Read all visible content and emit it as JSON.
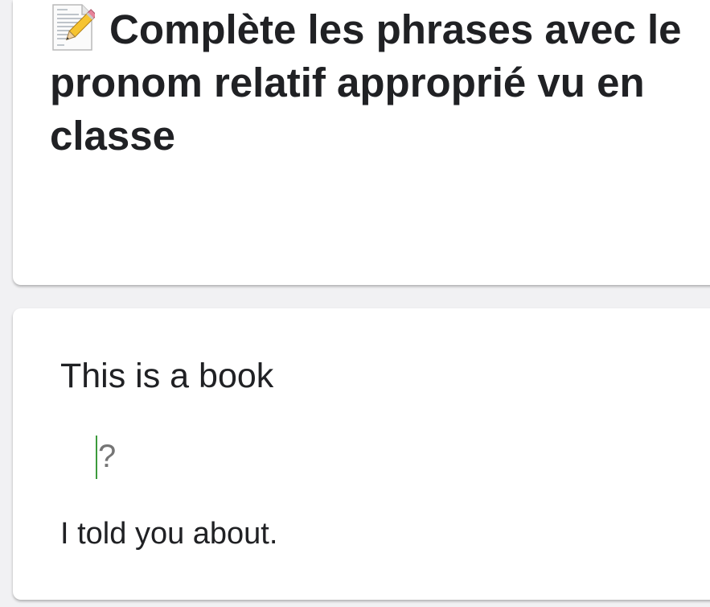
{
  "title_card": {
    "icon": "memo-icon",
    "title": "Complète les phrases avec le pronom relatif approprié vu en classe"
  },
  "question_card": {
    "sentence_before": "This is a book",
    "blank": {
      "value": "",
      "placeholder": "?"
    },
    "sentence_after": "I told you about."
  },
  "colors": {
    "card_background": "#ffffff",
    "page_background": "#f1f1f3",
    "caret": "#3c9a3c",
    "text": "#202124"
  }
}
